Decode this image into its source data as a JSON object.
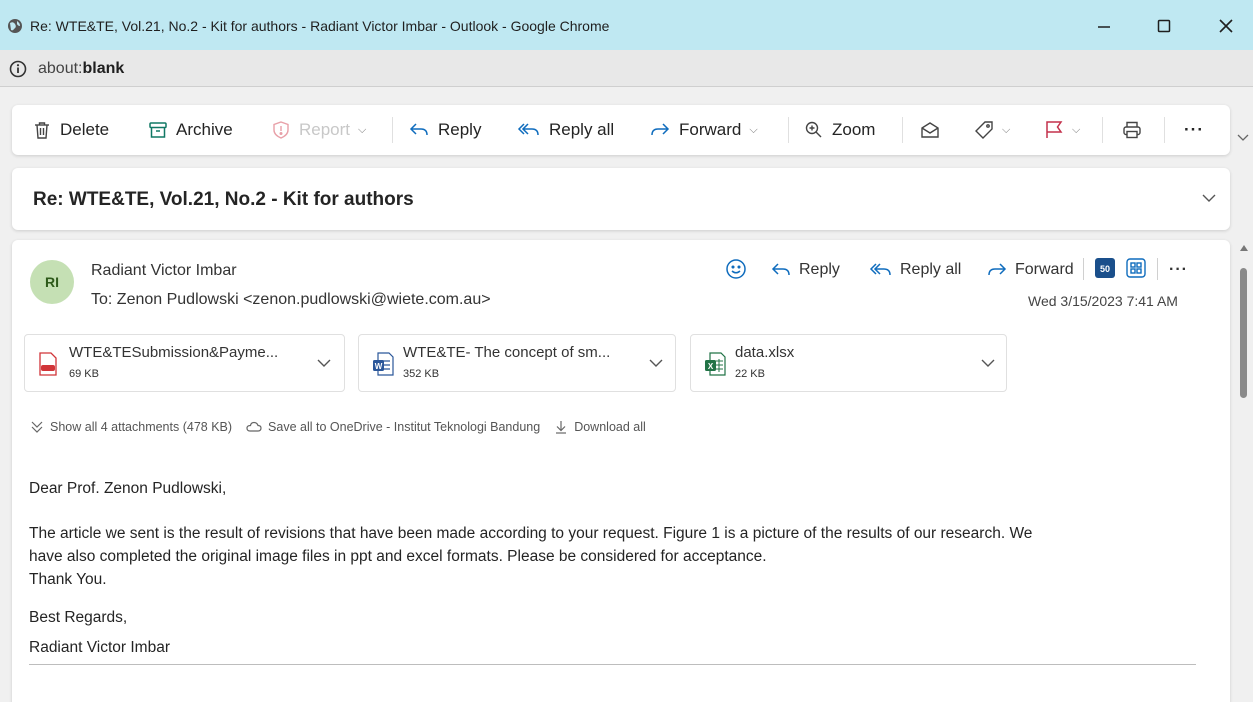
{
  "window": {
    "title": "Re: WTE&TE, Vol.21, No.2 - Kit for authors - Radiant Victor Imbar - Outlook - Google Chrome",
    "minimize_label": "—",
    "maximize_label": "□",
    "close_label": "✕"
  },
  "address": {
    "prefix": "about:",
    "host": "blank"
  },
  "toolbar": {
    "delete": "Delete",
    "archive": "Archive",
    "report": "Report",
    "reply": "Reply",
    "reply_all": "Reply all",
    "forward": "Forward",
    "zoom": "Zoom",
    "more": "···"
  },
  "subject": "Re: WTE&TE, Vol.21, No.2 - Kit for authors",
  "message": {
    "avatar_initials": "RI",
    "sender": "Radiant Victor Imbar",
    "to": "To:  Zenon Pudlowski <zenon.pudlowski@wiete.com.au>",
    "date": "Wed 3/15/2023 7:41 AM",
    "actions": {
      "reply": "Reply",
      "reply_all": "Reply all",
      "forward": "Forward",
      "more": "···"
    },
    "attachments": [
      {
        "name": "WTE&TESubmission&Payme...",
        "size": "69 KB",
        "type": "pdf"
      },
      {
        "name": "WTE&TE- The concept of sm...",
        "size": "352 KB",
        "type": "word"
      },
      {
        "name": "data.xlsx",
        "size": "22 KB",
        "type": "excel"
      }
    ],
    "attachment_actions": {
      "show_all": "Show all 4 attachments (478 KB)",
      "save_onedrive": "Save all to OneDrive - Institut Teknologi Bandung",
      "download_all": "Download all"
    },
    "body": {
      "greeting": "Dear Prof. Zenon Pudlowski,",
      "line1": "The article we sent is the result of revisions that have been made according to your request. Figure 1 is a picture of the results of our research. We",
      "line2": "have also completed the original image files in ppt and excel formats. Please be considered for acceptance.",
      "line3": "Thank You.",
      "regards": "Best Regards,",
      "signature": "Radiant Victor Imbar"
    }
  },
  "colors": {
    "titlebar": "#bfe8f2",
    "accent": "#0f6cbd",
    "flag": "#c4314b",
    "avatar_bg": "#c5e0b4"
  }
}
